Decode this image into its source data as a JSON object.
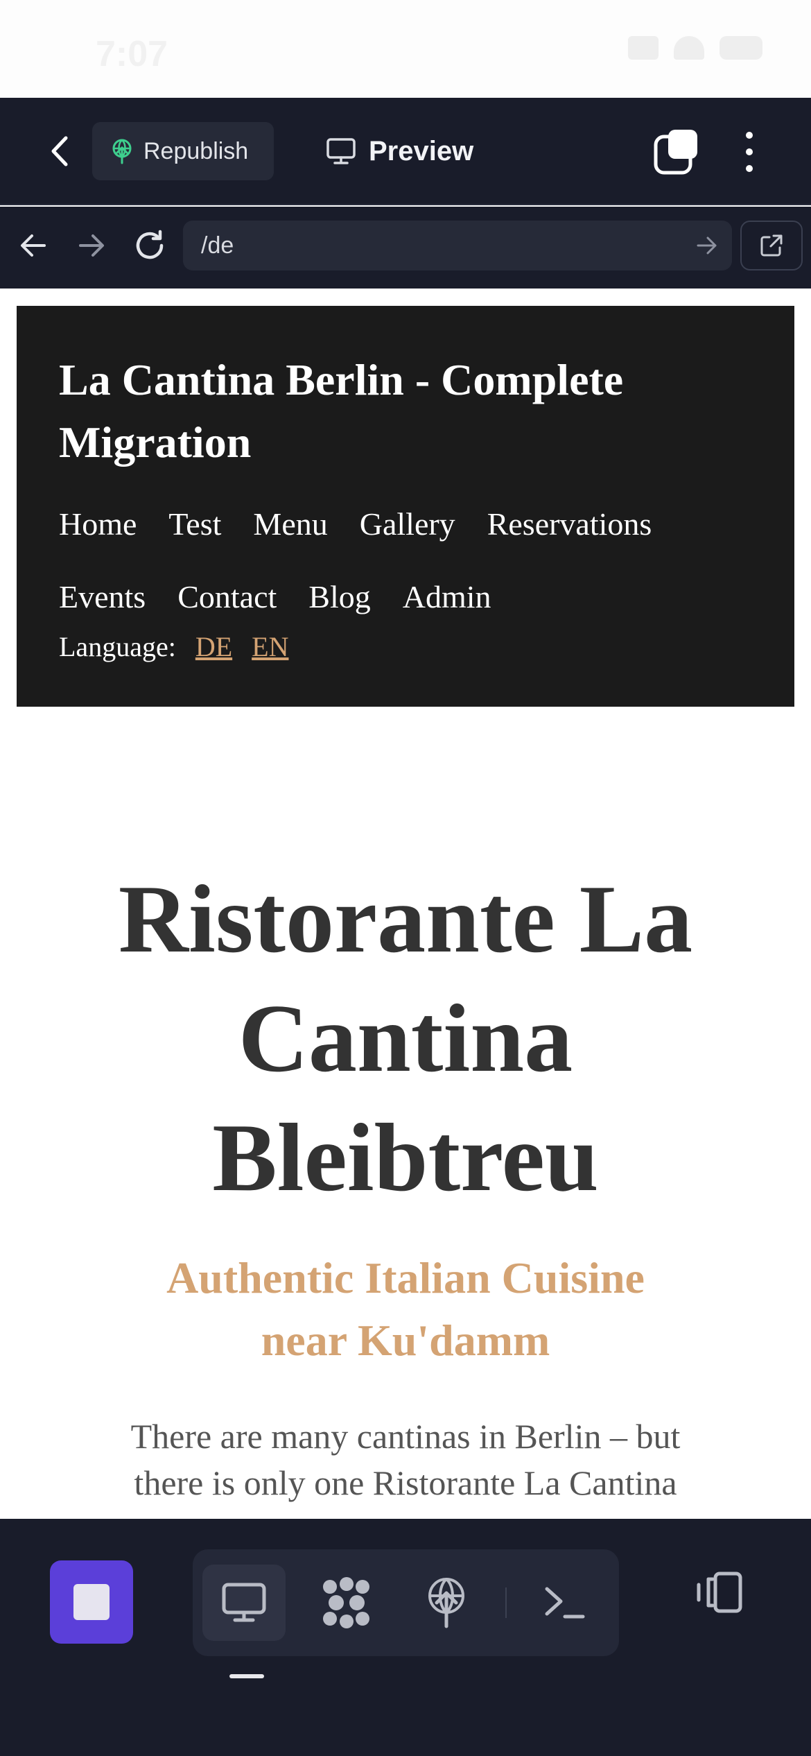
{
  "status_bar": {
    "time": "7:07",
    "icons": [
      "signal-icon",
      "wifi-icon",
      "battery-icon"
    ]
  },
  "app_bar": {
    "republish_label": "Republish",
    "preview_label": "Preview"
  },
  "browser": {
    "url": "/de"
  },
  "site": {
    "title": "La Cantina Berlin - Complete Migration",
    "nav": [
      "Home",
      "Test",
      "Menu",
      "Gallery",
      "Reservations",
      "Events",
      "Contact",
      "Blog",
      "Admin"
    ],
    "language_label": "Language:",
    "languages": [
      "DE",
      "EN"
    ]
  },
  "hero": {
    "title": "Ristorante La Cantina Bleibtreu",
    "subtitle": "Authentic Italian Cuisine near Ku'damm",
    "text": "There are many cantinas in Berlin – but there is only one Ristorante La Cantina"
  },
  "bottom_bar": {
    "tools": [
      "webview-icon",
      "extensions-icon",
      "deploy-icon",
      "shell-icon"
    ],
    "active_tool": "webview-icon"
  },
  "colors": {
    "chrome_bg": "#191c2a",
    "accent_purple": "#5b3fd9",
    "site_accent": "#d4a373",
    "site_header_bg": "#1b1b1b"
  }
}
